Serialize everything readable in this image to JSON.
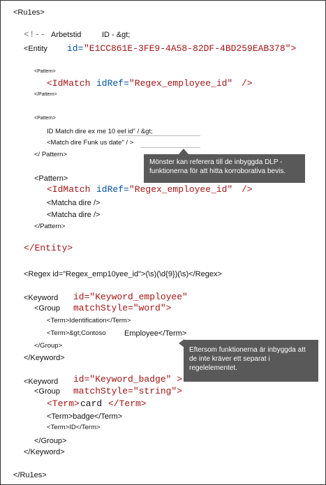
{
  "rules_open": "<Ru1es>",
  "comment_open": "<!--",
  "comment_label": "Arbetstid",
  "comment_id": "ID - &gt;",
  "entity_tag": "<Entity",
  "entity_id_attr": "id=",
  "entity_id_val": "\"E1CC861E-3FE9-4A58-82DF-4BD259EAB378\">",
  "pattern1_open": "<Pattern>",
  "idmatch1_tag": "<IdMatch",
  "idmatch1_attr": "idRef=",
  "idmatch1_val": "\"Regex_employee_id\"",
  "idmatch1_close": "/>",
  "pattern1_close": "</Pattern>",
  "pattern2_open": "<Pattern>",
  "pattern2_line1": "ID Match dire ex me 10 eel id\" / &gt;",
  "pattern2_line2": "<Match dire Funk us date\" / >",
  "pattern2_close": "</ Pattern>",
  "callout1": "Mönster kan referera till de inbyggda DLP -funktionerna för att hitta korroborativa bevis.",
  "pattern3_open": "<Pattern>",
  "idmatch3_tag": "<IdMatch",
  "idmatch3_attr": "idRef=",
  "idmatch3_val": "\"Regex_employee_id\"",
  "idmatch3_close": "/>",
  "match3a": "<Matcha dire />",
  "match3b": "<Matcha dire />",
  "pattern3_close": "</Pattern>",
  "entity_close": "</Entity>",
  "regex_line": "<Regex id=\"Regex_emp10yee_id\">(\\s)(\\d{9})(\\s)</Regex>",
  "kw1_tag": "<Keyword",
  "kw1_id": "id=\"Keyword_employee\"",
  "kw1_group": "<Group",
  "kw1_match": "matchStyle=\"word\">",
  "kw1_term1": "<Term>Identification</Term>",
  "kw1_term2": "<Term>&gt;Contoso",
  "kw1_term2b": "Employee</Term>",
  "kw1_group_close": "</Group>",
  "kw1_close": "</Keyword>",
  "callout2": "Eftersom funktionerna är inbyggda att de inte kräver ett separat i regelelementet.",
  "kw2_tag": "<Keyword",
  "kw2_id": "id=\"Keyword_badge\" >",
  "kw2_group": "<Group",
  "kw2_match": "matchStyle=\"string\">",
  "kw2_term1_open": "<Term>",
  "kw2_term1_val": "card",
  "kw2_term1_close": "</Term>",
  "kw2_term2": "<Term>badge</Term>",
  "kw2_term3": "<Term>ID</Term>",
  "kw2_group_close": "</Group>",
  "kw2_close": "</Keyword>",
  "rules_close": "</Ru1es>",
  "colors": {
    "string": "#a31515",
    "attribute": "#0451a5",
    "callout_bg": "#595959"
  }
}
